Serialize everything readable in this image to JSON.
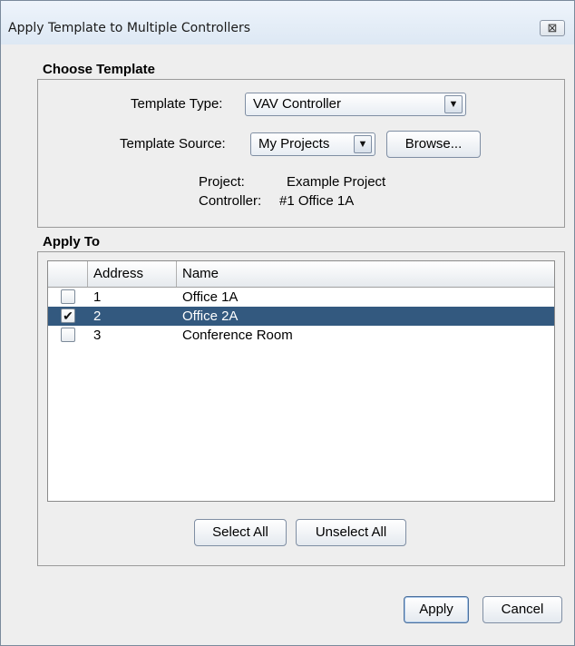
{
  "window": {
    "title": "Apply Template to Multiple Controllers",
    "close_glyph": "⊠"
  },
  "choose_template": {
    "heading": "Choose Template",
    "template_type_label": "Template Type:",
    "template_type_value": "VAV Controller",
    "template_source_label": "Template Source:",
    "template_source_value": "My Projects",
    "browse_label": "Browse...",
    "project_label": "Project:",
    "project_value": "Example Project",
    "controller_label": "Controller:",
    "controller_value": "#1 Office 1A"
  },
  "apply_to": {
    "heading": "Apply To",
    "columns": [
      "",
      "Address",
      "Name"
    ],
    "rows": [
      {
        "checked": false,
        "address": "1",
        "name": "Office 1A",
        "selected": false
      },
      {
        "checked": true,
        "address": "2",
        "name": "Office 2A",
        "selected": true
      },
      {
        "checked": false,
        "address": "3",
        "name": "Conference Room",
        "selected": false
      }
    ],
    "select_all_label": "Select All",
    "unselect_all_label": "Unselect All"
  },
  "footer": {
    "apply_label": "Apply",
    "cancel_label": "Cancel"
  },
  "colors": {
    "selection": "#33597f",
    "dialog_bg": "#eeeeee"
  },
  "icons": {
    "dropdown": "chevron-down-icon",
    "checkbox": "check-icon",
    "close": "close-icon"
  }
}
